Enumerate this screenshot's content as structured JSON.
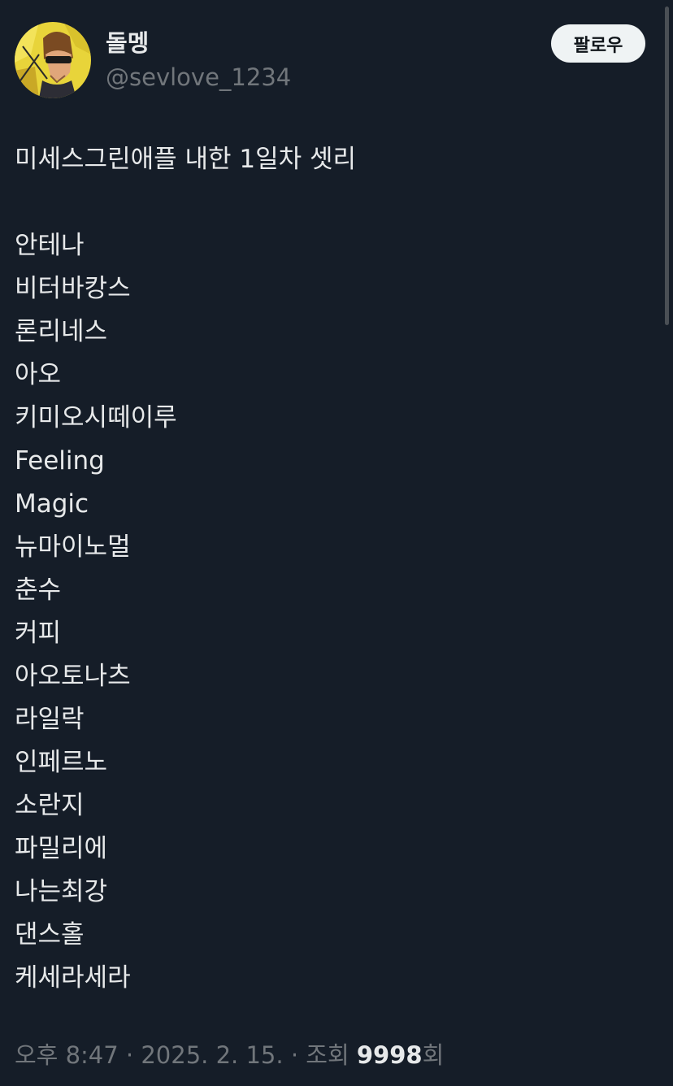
{
  "author": {
    "display_name": "돌멩",
    "handle": "@sevlove_1234"
  },
  "follow_button_label": "팔로우",
  "tweet": {
    "title_line": "미세스그린애플 내한 1일차 셋리",
    "setlist": [
      "안테나",
      "비터바캉스",
      "론리네스",
      "아오",
      "키미오시떼이루",
      "Feeling",
      "Magic",
      "뉴마이노멀",
      "춘수",
      "커피",
      "아오토나츠",
      "라일락",
      "인페르노",
      "소란지",
      "파밀리에",
      "나는최강",
      "댄스홀",
      "케세라세라"
    ]
  },
  "meta": {
    "time": "오후 8:47",
    "separator": " · ",
    "date": "2025. 2. 15.",
    "views_prefix": "조회 ",
    "views_count": "9998",
    "views_suffix": "회"
  },
  "icons": {
    "avatar": "avatar-image"
  },
  "colors": {
    "background": "#151d28",
    "primary_text": "#e7e9ea",
    "secondary_text": "#71767b",
    "button_bg": "#eff3f4"
  }
}
